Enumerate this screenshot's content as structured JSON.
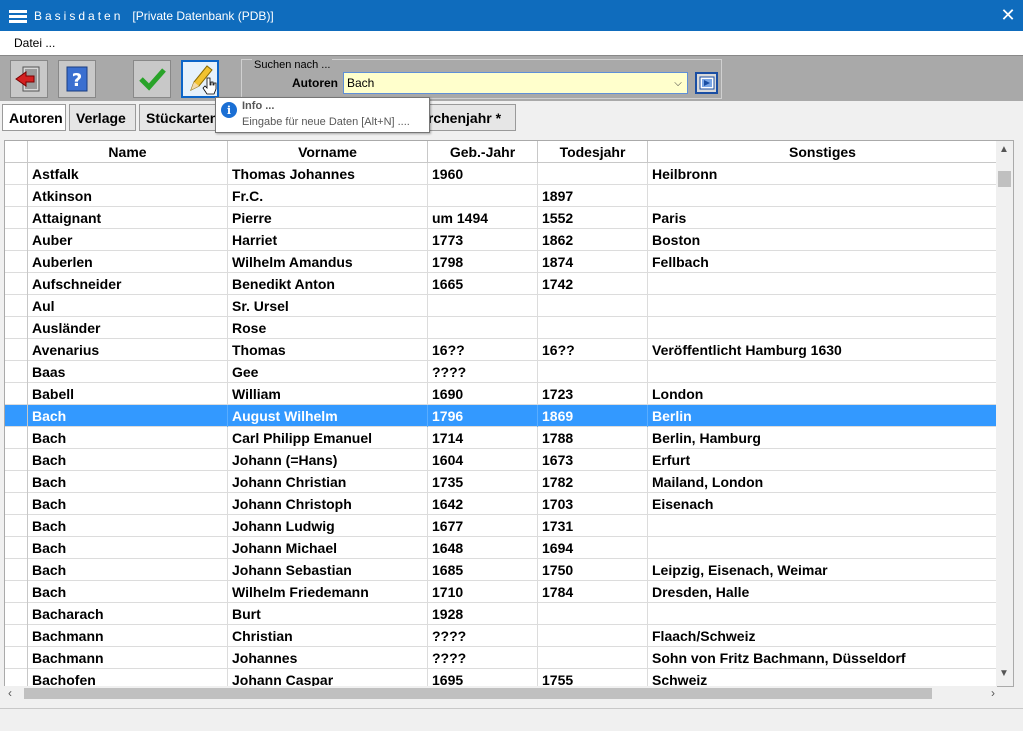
{
  "window": {
    "title_main": "Basisdaten",
    "title_sub": "[Private Datenbank (PDB)]",
    "close_glyph": "✕"
  },
  "menu": {
    "items": [
      {
        "label": "Datei ..."
      }
    ]
  },
  "toolbar": {
    "buttons": [
      {
        "icon": "exit-icon"
      },
      {
        "icon": "help-icon"
      },
      {
        "icon": "checkmark-icon"
      },
      {
        "icon": "pencil-icon"
      }
    ],
    "search": {
      "legend": "Suchen nach ...",
      "label": "Autoren",
      "value": "Bach"
    }
  },
  "tabs": [
    {
      "label": "Autoren",
      "active": true
    },
    {
      "label": "Verlage",
      "active": false
    },
    {
      "label": "Stückarten",
      "active": false
    },
    {
      "label": "irchenjahr *",
      "active": false
    }
  ],
  "tooltip": {
    "title": "Info ...",
    "body": "Eingabe für neue Daten [Alt+N] ...."
  },
  "table": {
    "columns": [
      "Name",
      "Vorname",
      "Geb.-Jahr",
      "Todesjahr",
      "Sonstiges"
    ],
    "selected_index": 11,
    "rows": [
      [
        "Astfalk",
        "Thomas Johannes",
        "1960",
        "",
        "Heilbronn"
      ],
      [
        "Atkinson",
        "Fr.C.",
        "",
        "1897",
        ""
      ],
      [
        "Attaignant",
        "Pierre",
        "um 1494",
        "1552",
        "Paris"
      ],
      [
        "Auber",
        "Harriet",
        "1773",
        "1862",
        "Boston"
      ],
      [
        "Auberlen",
        "Wilhelm Amandus",
        "1798",
        "1874",
        "Fellbach"
      ],
      [
        "Aufschneider",
        "Benedikt Anton",
        "1665",
        "1742",
        ""
      ],
      [
        "Aul",
        "Sr. Ursel",
        "",
        "",
        ""
      ],
      [
        "Ausländer",
        "Rose",
        "",
        "",
        ""
      ],
      [
        "Avenarius",
        "Thomas",
        "16??",
        "16??",
        "Veröffentlicht Hamburg 1630"
      ],
      [
        "Baas",
        "Gee",
        "????",
        "",
        ""
      ],
      [
        "Babell",
        "William",
        "1690",
        "1723",
        "London"
      ],
      [
        "Bach",
        "August Wilhelm",
        "1796",
        "1869",
        "Berlin"
      ],
      [
        "Bach",
        "Carl Philipp Emanuel",
        "1714",
        "1788",
        "Berlin, Hamburg"
      ],
      [
        "Bach",
        "Johann (=Hans)",
        "1604",
        "1673",
        "Erfurt"
      ],
      [
        "Bach",
        "Johann Christian",
        "1735",
        "1782",
        "Mailand, London"
      ],
      [
        "Bach",
        "Johann Christoph",
        "1642",
        "1703",
        "Eisenach"
      ],
      [
        "Bach",
        "Johann Ludwig",
        "1677",
        "1731",
        ""
      ],
      [
        "Bach",
        "Johann Michael",
        "1648",
        "1694",
        ""
      ],
      [
        "Bach",
        "Johann Sebastian",
        "1685",
        "1750",
        "Leipzig, Eisenach, Weimar"
      ],
      [
        "Bach",
        "Wilhelm Friedemann",
        "1710",
        "1784",
        "Dresden, Halle"
      ],
      [
        "Bacharach",
        "Burt",
        "1928",
        "",
        ""
      ],
      [
        "Bachmann",
        "Christian",
        "????",
        "",
        "Flaach/Schweiz"
      ],
      [
        "Bachmann",
        "Johannes",
        "????",
        "",
        "Sohn von Fritz Bachmann, Düsseldorf"
      ],
      [
        "Bachofen",
        "Johann Caspar",
        "1695",
        "1755",
        "Schweiz"
      ]
    ]
  },
  "colors": {
    "titlebar": "#0f6cbd",
    "selection": "#3399ff",
    "search_bg": "#ffffcc",
    "toolbar": "#a9a9a9"
  }
}
